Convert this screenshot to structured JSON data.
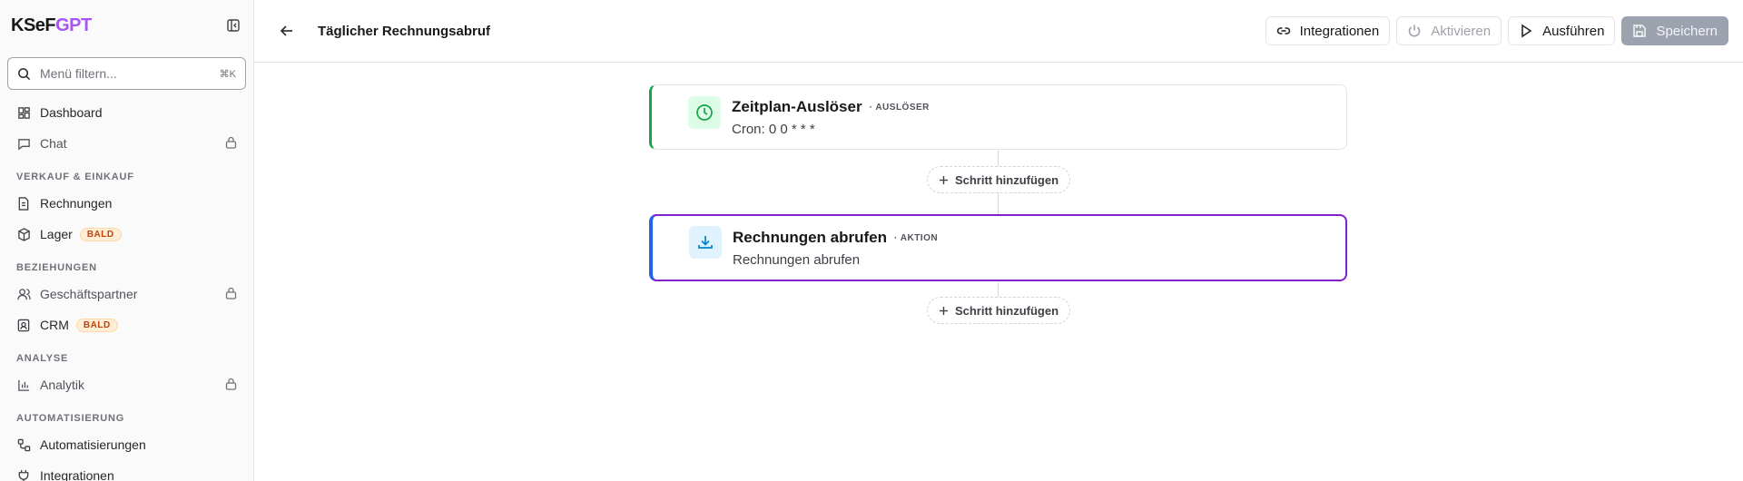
{
  "sidebar": {
    "logo_a": "KSeF",
    "logo_b": "GPT",
    "search_placeholder": "Menü filtern...",
    "search_shortcut": "⌘K",
    "items": {
      "dashboard": "Dashboard",
      "chat": "Chat",
      "rechnungen": "Rechnungen",
      "lager": "Lager",
      "geschaeftspartner": "Geschäftspartner",
      "crm": "CRM",
      "analytik": "Analytik",
      "automatisierungen": "Automatisierungen",
      "integrationen": "Integrationen"
    },
    "sections": {
      "verkauf": "VERKAUF & EINKAUF",
      "beziehungen": "BEZIEHUNGEN",
      "analyse": "ANALYSE",
      "automatisierung": "AUTOMATISIERUNG"
    },
    "badge_soon": "BALD"
  },
  "header": {
    "title": "Täglicher Rechnungsabruf",
    "buttons": {
      "integrationen": "Integrationen",
      "aktivieren": "Aktivieren",
      "ausfuehren": "Ausführen",
      "speichern": "Speichern"
    }
  },
  "workflow": {
    "trigger": {
      "title": "Zeitplan-Auslöser",
      "type": "· AUSLÖSER",
      "subtitle": "Cron: 0 0 * * *"
    },
    "action": {
      "title": "Rechnungen abrufen",
      "type": "· AKTION",
      "subtitle": "Rechnungen abrufen"
    },
    "add_step_label": "Schritt hinzufügen"
  },
  "colors": {
    "brand": "#a855f7",
    "trigger_accent": "#16a34a",
    "action_border": "#7e22ce",
    "action_accent": "#2563eb"
  }
}
